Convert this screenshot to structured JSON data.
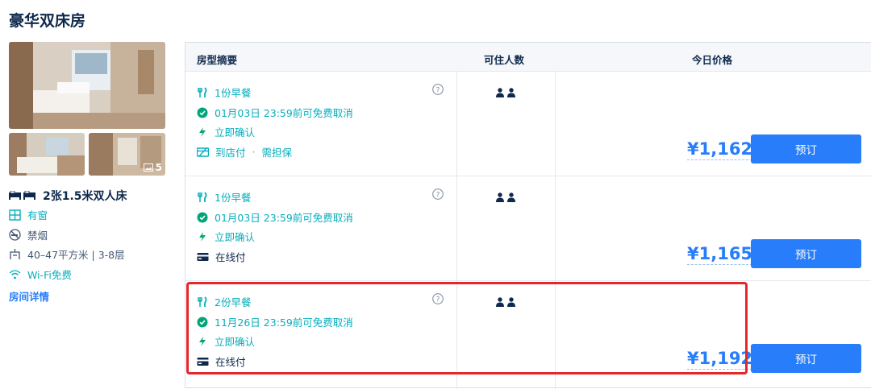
{
  "room": {
    "title": "豪华双床房",
    "photo_count": "5",
    "bed": "2张1.5米双人床",
    "features": [
      {
        "icon": "window-icon",
        "text": "有窗",
        "color": "#06aebd"
      },
      {
        "icon": "no-smoking-icon",
        "text": "禁烟",
        "color": "#455873"
      },
      {
        "icon": "area-icon",
        "text": "40–47平方米 | 3-8层",
        "color": "#455873"
      },
      {
        "icon": "wifi-icon",
        "text": "Wi-Fi免费",
        "color": "#06aebd"
      }
    ],
    "detail_link": "房间详情"
  },
  "table": {
    "headers": {
      "summary": "房型摘要",
      "occupancy": "可住人数",
      "price": "今日价格"
    },
    "rows": [
      {
        "breakfast": "1份早餐",
        "cancel": "01月03日 23:59前可免费取消",
        "confirm": "立即确认",
        "payment": "到店付",
        "payment_extra": "需担保",
        "price": "¥1,162",
        "book": "预订"
      },
      {
        "breakfast": "1份早餐",
        "cancel": "01月03日 23:59前可免费取消",
        "confirm": "立即确认",
        "payment": "在线付",
        "price": "¥1,165",
        "book": "预订"
      },
      {
        "breakfast": "2份早餐",
        "cancel": "11月26日 23:59前可免费取消",
        "confirm": "立即确认",
        "payment": "在线付",
        "price": "¥1,192",
        "book": "预订"
      }
    ]
  },
  "colors": {
    "accent": "#287dfa",
    "green": "#06aebd",
    "highlight": "#e5262a",
    "text": "#0f294d"
  }
}
